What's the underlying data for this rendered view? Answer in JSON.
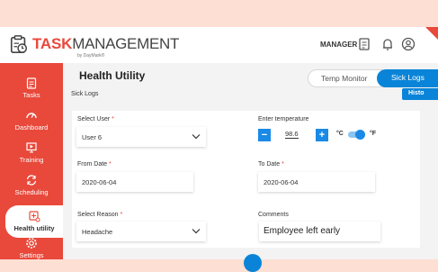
{
  "app": {
    "logo_bold": "TASK",
    "logo_rest": "MANAGEMENT",
    "logo_sub": "by DayMark®"
  },
  "topbar": {
    "role": "MANAGER",
    "icons": [
      "clipboard-icon",
      "bell-icon",
      "user-icon"
    ]
  },
  "sidebar": {
    "items": [
      {
        "label": "Tasks",
        "icon": "clipboard-icon",
        "active": false
      },
      {
        "label": "Dashboard",
        "icon": "gauge-icon",
        "active": false
      },
      {
        "label": "Training",
        "icon": "monitor-icon",
        "active": false
      },
      {
        "label": "Scheduling",
        "icon": "cycle-icon",
        "active": false
      },
      {
        "label": "Health utility",
        "icon": "health-icon",
        "active": true
      },
      {
        "label": "Settings",
        "icon": "gear-icon",
        "active": false
      }
    ]
  },
  "main": {
    "title": "Health Utility",
    "tabs": [
      "Temp Monitor",
      "Sick Logs"
    ],
    "active_tab": "Sick Logs",
    "subtitle": "Sick Logs",
    "history_button": "Histo"
  },
  "form": {
    "select_user_label": "Select User",
    "select_user_value": "User 6",
    "enter_temp_label": "Enter temperature",
    "temp_value": "98.6",
    "unit_c": "°C",
    "unit_f": "°F",
    "unit_selected": "°F",
    "from_date_label": "From Date",
    "from_date_value": "2020-06-04",
    "to_date_label": "To Date",
    "to_date_value": "2020-06-04",
    "reason_label": "Select Reason",
    "reason_value": "Headache",
    "comments_label": "Comments",
    "comments_value": "Employee left early",
    "required_mark": "*",
    "minus": "−",
    "plus": "+"
  },
  "colors": {
    "brand": "#e8493b",
    "accent": "#0a84d8",
    "background": "#fde0d3"
  }
}
